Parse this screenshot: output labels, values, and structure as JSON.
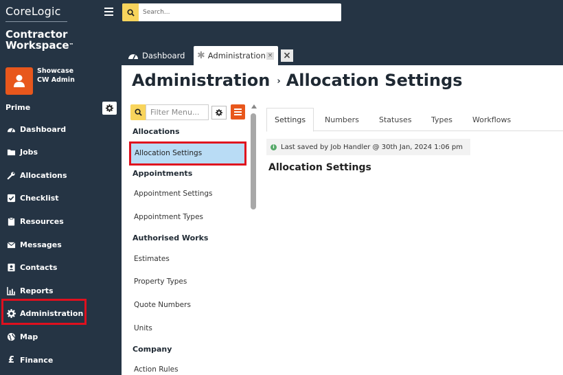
{
  "brand": {
    "name": "CoreLogic",
    "product_line1": "Contractor",
    "product_line2": "Workspace",
    "tm": "™"
  },
  "user": {
    "name": "Showcase",
    "role": "CW Admin"
  },
  "sidebar": {
    "section": "Prime",
    "items": [
      {
        "label": "Dashboard",
        "icon": "dashboard-icon"
      },
      {
        "label": "Jobs",
        "icon": "folder-icon"
      },
      {
        "label": "Allocations",
        "icon": "wrench-icon"
      },
      {
        "label": "Checklist",
        "icon": "checkbox-icon"
      },
      {
        "label": "Resources",
        "icon": "clipboard-icon"
      },
      {
        "label": "Messages",
        "icon": "envelope-icon"
      },
      {
        "label": "Contacts",
        "icon": "contact-card-icon"
      },
      {
        "label": "Reports",
        "icon": "bar-chart-icon"
      },
      {
        "label": "Administration",
        "icon": "gear-icon"
      },
      {
        "label": "Map",
        "icon": "globe-icon"
      },
      {
        "label": "Finance",
        "icon": "pound-icon"
      }
    ]
  },
  "topbar": {
    "search_placeholder": "Search..."
  },
  "tabs": {
    "dashboard": "Dashboard",
    "administration": "Administration",
    "close": "×"
  },
  "page": {
    "title": "Administration",
    "separator": "›",
    "subtitle": "Allocation Settings"
  },
  "submenu": {
    "filter_placeholder": "Filter Menu...",
    "headings": [
      "Allocations",
      "Appointments",
      "Authorised Works",
      "Company"
    ],
    "active_item": "Allocation Settings",
    "items": [
      "Appointment Settings",
      "Appointment Types",
      "Estimates",
      "Property Types",
      "Quote Numbers",
      "Units",
      "Action Rules"
    ]
  },
  "content": {
    "tabs": [
      "Settings",
      "Numbers",
      "Statuses",
      "Types",
      "Workflows"
    ],
    "active_tab": "Settings",
    "saved_text": "Last saved by Job Handler @ 30th Jan, 2024 1:06 pm",
    "section_title": "Allocation Settings"
  },
  "colors": {
    "sidebar_bg": "#253444",
    "accent_orange": "#e8571c",
    "search_yellow": "#f8d45c",
    "highlight_red": "#e0101e",
    "active_blue": "#b9dcf5"
  }
}
